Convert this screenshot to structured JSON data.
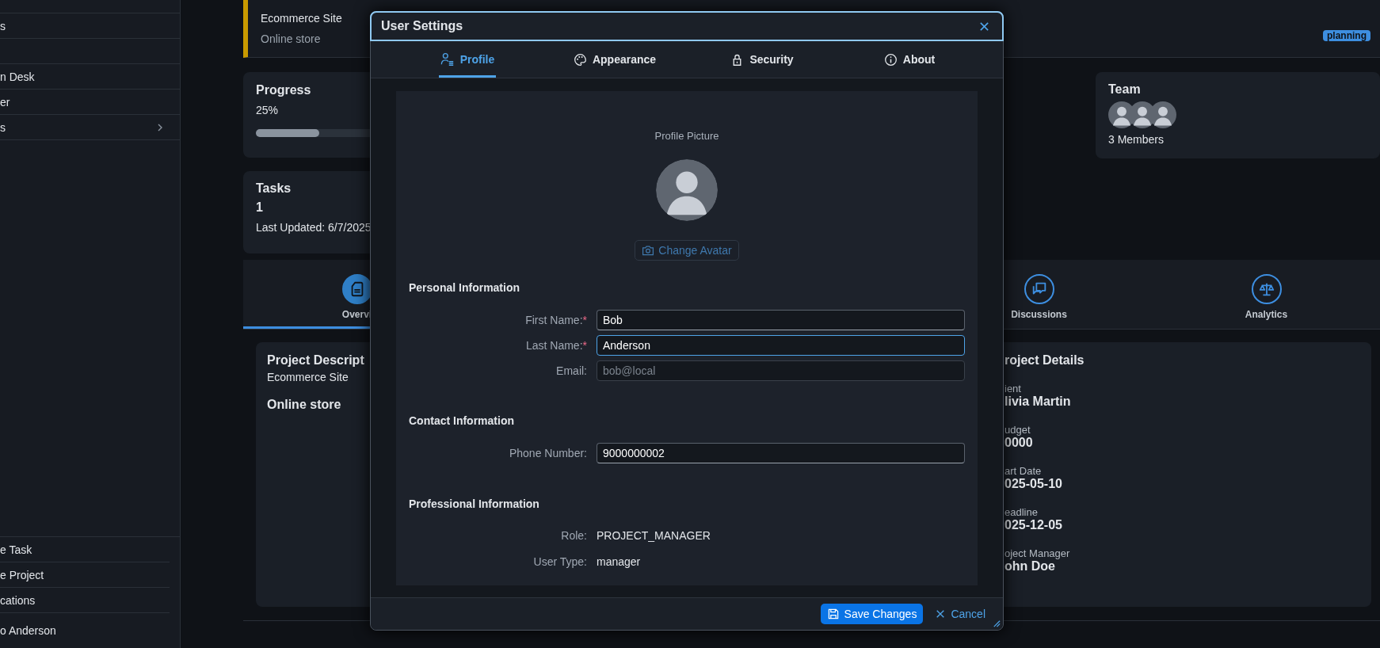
{
  "sidebar": {
    "items": [
      {
        "kind": "link",
        "label": "s",
        "expandable": false
      },
      {
        "kind": "blank"
      },
      {
        "kind": "link",
        "label": "n Desk",
        "expandable": false
      },
      {
        "kind": "link",
        "label": "er",
        "expandable": false
      },
      {
        "kind": "link",
        "label": "s",
        "expandable": true
      }
    ],
    "actions": [
      "e Task",
      "e Project",
      "cations"
    ],
    "user": "o Anderson"
  },
  "project": {
    "name": "Ecommerce Site",
    "description": "Online store",
    "status": "planning"
  },
  "progress": {
    "title": "Progress",
    "value": "25%",
    "level": 0.25
  },
  "tasks": {
    "title": "Tasks",
    "count": "1",
    "updated": "Last Updated: 6/7/2025"
  },
  "team": {
    "title": "Team",
    "count": "3 Members"
  },
  "tabs": [
    {
      "label": "Overvi",
      "selected": true
    },
    {
      "label": "Discussions",
      "selected": false
    },
    {
      "label": "Analytics",
      "selected": false
    }
  ],
  "description_card": {
    "title": "Project Descript",
    "subtitle": "Ecommerce Site",
    "body": "Online store"
  },
  "details_card": {
    "title": "roject Details",
    "fields": [
      {
        "label": "ient",
        "value": "livia Martin"
      },
      {
        "label": "udget",
        "value": "0000"
      },
      {
        "label": "art Date",
        "value": "025-05-10"
      },
      {
        "label": "eadline",
        "value": "025-12-05"
      },
      {
        "label": "oject Manager",
        "value": "ohn Doe"
      }
    ]
  },
  "dialog": {
    "title": "User Settings",
    "tabs": [
      {
        "label": "Profile",
        "selected": true
      },
      {
        "label": "Appearance",
        "selected": false
      },
      {
        "label": "Security",
        "selected": false
      },
      {
        "label": "About",
        "selected": false
      }
    ],
    "avatar": {
      "label": "Profile Picture",
      "button": "Change Avatar"
    },
    "sections": [
      {
        "title": "Personal Information",
        "fields": [
          {
            "kind": "input",
            "label": "First Name:",
            "marker": "*",
            "value": "Bob",
            "focused": false,
            "disabled": false
          },
          {
            "kind": "input",
            "label": "Last Name:",
            "marker": "*",
            "value": "Anderson",
            "focused": true,
            "disabled": false
          },
          {
            "kind": "input",
            "label": "Email:",
            "value": "bob@local",
            "focused": false,
            "disabled": true
          }
        ]
      },
      {
        "title": "Contact Information",
        "fields": [
          {
            "kind": "input",
            "label": "Phone Number:",
            "value": "9000000002",
            "focused": false,
            "disabled": false
          }
        ]
      },
      {
        "title": "Professional Information",
        "fields": [
          {
            "kind": "text",
            "label": "Role:",
            "value": "PROJECT_MANAGER"
          },
          {
            "kind": "text",
            "label": "User Type:",
            "value": "manager"
          }
        ]
      }
    ],
    "buttons": [
      {
        "kind": "primary",
        "label": "Save Changes"
      },
      {
        "kind": "text",
        "label": "Cancel"
      }
    ]
  }
}
